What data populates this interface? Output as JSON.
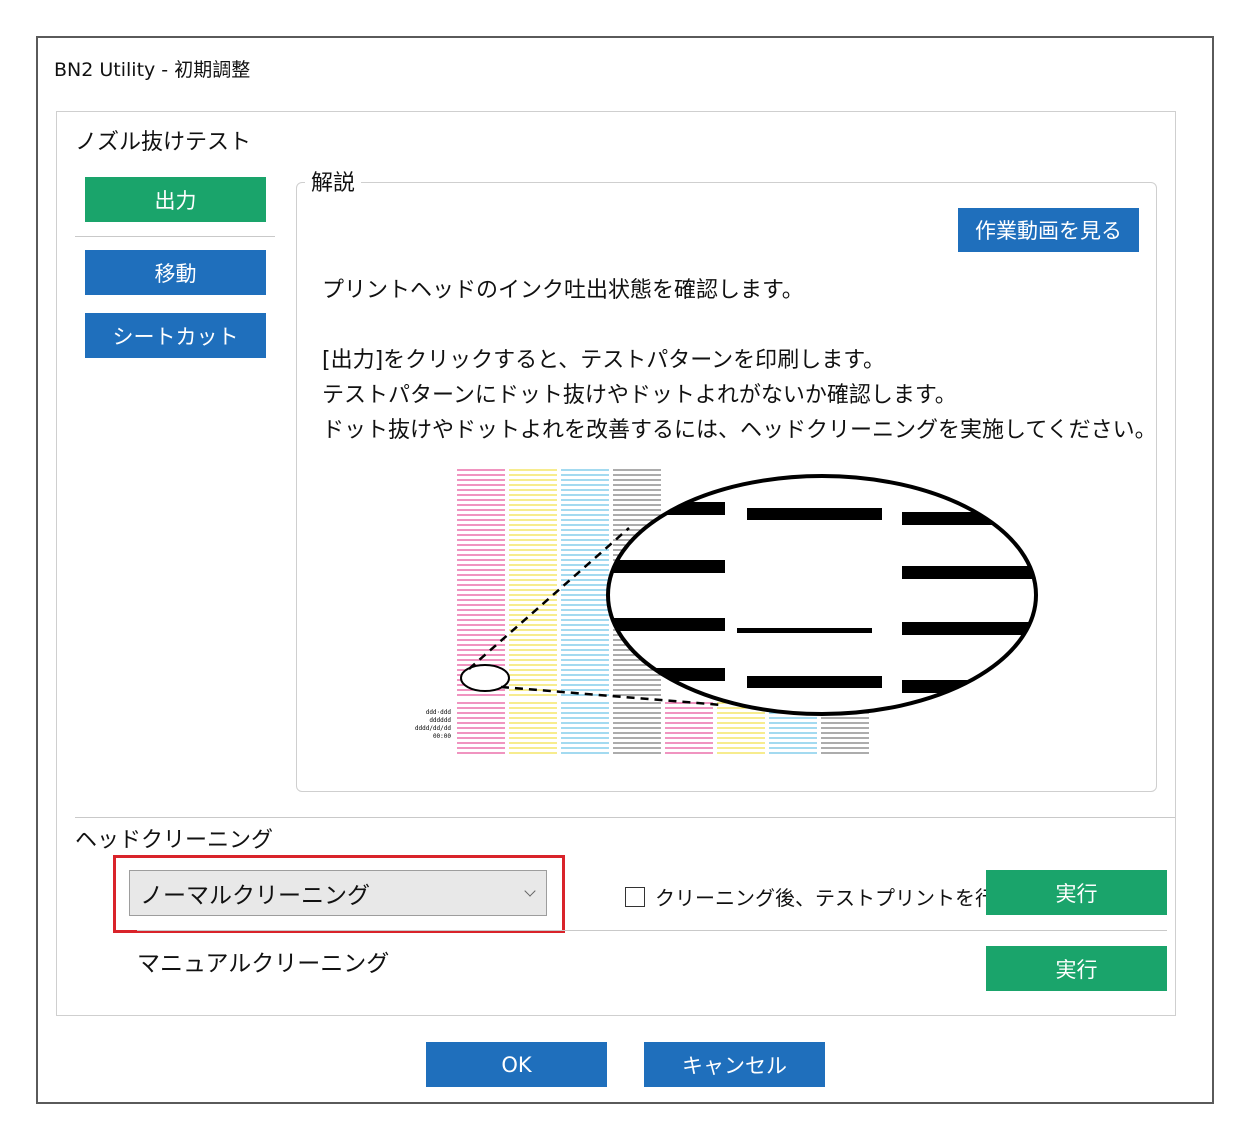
{
  "window": {
    "title": "BN2 Utility - 初期調整"
  },
  "nozzle_test": {
    "title": "ノズル抜けテスト",
    "output_label": "出力",
    "move_label": "移動",
    "sheet_cut_label": "シートカット"
  },
  "description": {
    "group_label": "解説",
    "video_button_label": "作業動画を見る",
    "line1": "プリントヘッドのインク吐出状態を確認します。",
    "line2": "[出力]をクリックすると、テストパターンを印刷します。",
    "line3": "テストパターンにドット抜けやドットよれがないか確認します。",
    "line4": "ドット抜けやドットよれを改善するには、ヘッドクリーニングを実施してください。"
  },
  "illustration": {
    "label_lines": [
      "ddd·ddd",
      "dddddd",
      "dddd/dd/dd",
      "00:00"
    ],
    "pattern_colors": [
      "#e8559b",
      "#f2e04a",
      "#6cc4e6",
      "#7a7a7a"
    ]
  },
  "head_cleaning": {
    "title": "ヘッドクリーニング",
    "mode_selected": "ノーマルクリーニング",
    "test_print_checkbox_label": "クリーニング後、テストプリントを行う",
    "test_print_checked": false,
    "execute_label": "実行",
    "manual_label": "マニュアルクリーニング",
    "manual_execute_label": "実行"
  },
  "footer": {
    "ok_label": "OK",
    "cancel_label": "キャンセル"
  },
  "colors": {
    "green": "#1aa46b",
    "blue": "#1f6fbc",
    "highlight": "#d9232a"
  }
}
